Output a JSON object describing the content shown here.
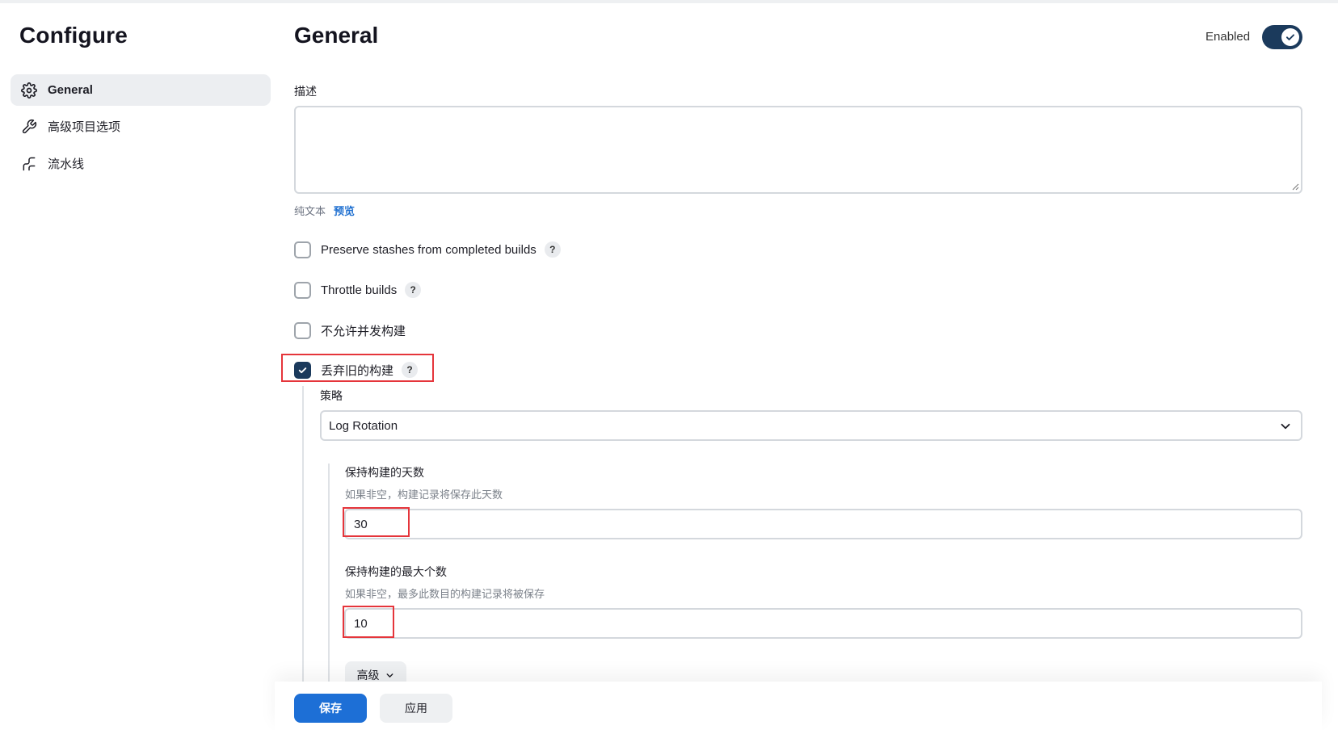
{
  "sidebar": {
    "title": "Configure",
    "items": [
      {
        "label": "General",
        "icon": "gear-icon"
      },
      {
        "label": "高级项目选项",
        "icon": "wrench-icon"
      },
      {
        "label": "流水线",
        "icon": "pipeline-icon"
      }
    ]
  },
  "header": {
    "title": "General",
    "enabled_label": "Enabled",
    "enabled": true
  },
  "description": {
    "label": "描述",
    "value": "",
    "format_label": "纯文本",
    "preview_label": "预览"
  },
  "options": [
    {
      "label": "Preserve stashes from completed builds",
      "checked": false,
      "help": "?"
    },
    {
      "label": "Throttle builds",
      "checked": false,
      "help": "?"
    },
    {
      "label": "不允许并发构建",
      "checked": false
    },
    {
      "label": "丢弃旧的构建",
      "checked": true,
      "help": "?"
    }
  ],
  "strategy": {
    "label": "策略",
    "selected": "Log Rotation"
  },
  "days_to_keep": {
    "label": "保持构建的天数",
    "hint": "如果非空，构建记录将保存此天数",
    "value": "30"
  },
  "max_builds": {
    "label": "保持构建的最大个数",
    "hint": "如果非空，最多此数目的构建记录将被保存",
    "value": "10"
  },
  "advanced_label": "高级",
  "footer": {
    "save_label": "保存",
    "apply_label": "应用"
  },
  "colors": {
    "primary": "#1d6fd6",
    "toggle_on": "#1b3a5c",
    "highlight": "#e5353b"
  }
}
